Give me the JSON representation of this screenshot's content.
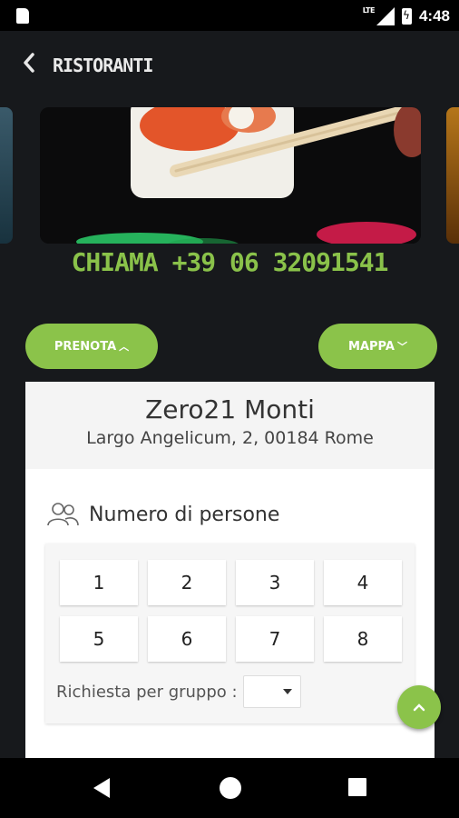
{
  "status_bar": {
    "time": "4:48",
    "network": "LTE"
  },
  "header": {
    "title": "RISTORANTI"
  },
  "carousel": {
    "image": "sushi-chopsticks-photo"
  },
  "phone": {
    "label": "CHIAMA +39 06 32091541"
  },
  "actions": {
    "prenota": "PRENOTA",
    "mappa": "MAPPA"
  },
  "restaurant": {
    "name": "Zero21 Monti",
    "address": "Largo Angelicum, 2, 00184 Rome"
  },
  "booking": {
    "people_label": "Numero di persone",
    "numbers": [
      "1",
      "2",
      "3",
      "4",
      "5",
      "6",
      "7",
      "8"
    ],
    "group_label": "Richiesta per gruppo :",
    "group_value": ""
  },
  "colors": {
    "accent": "#8bc34a",
    "background": "#17191c"
  }
}
